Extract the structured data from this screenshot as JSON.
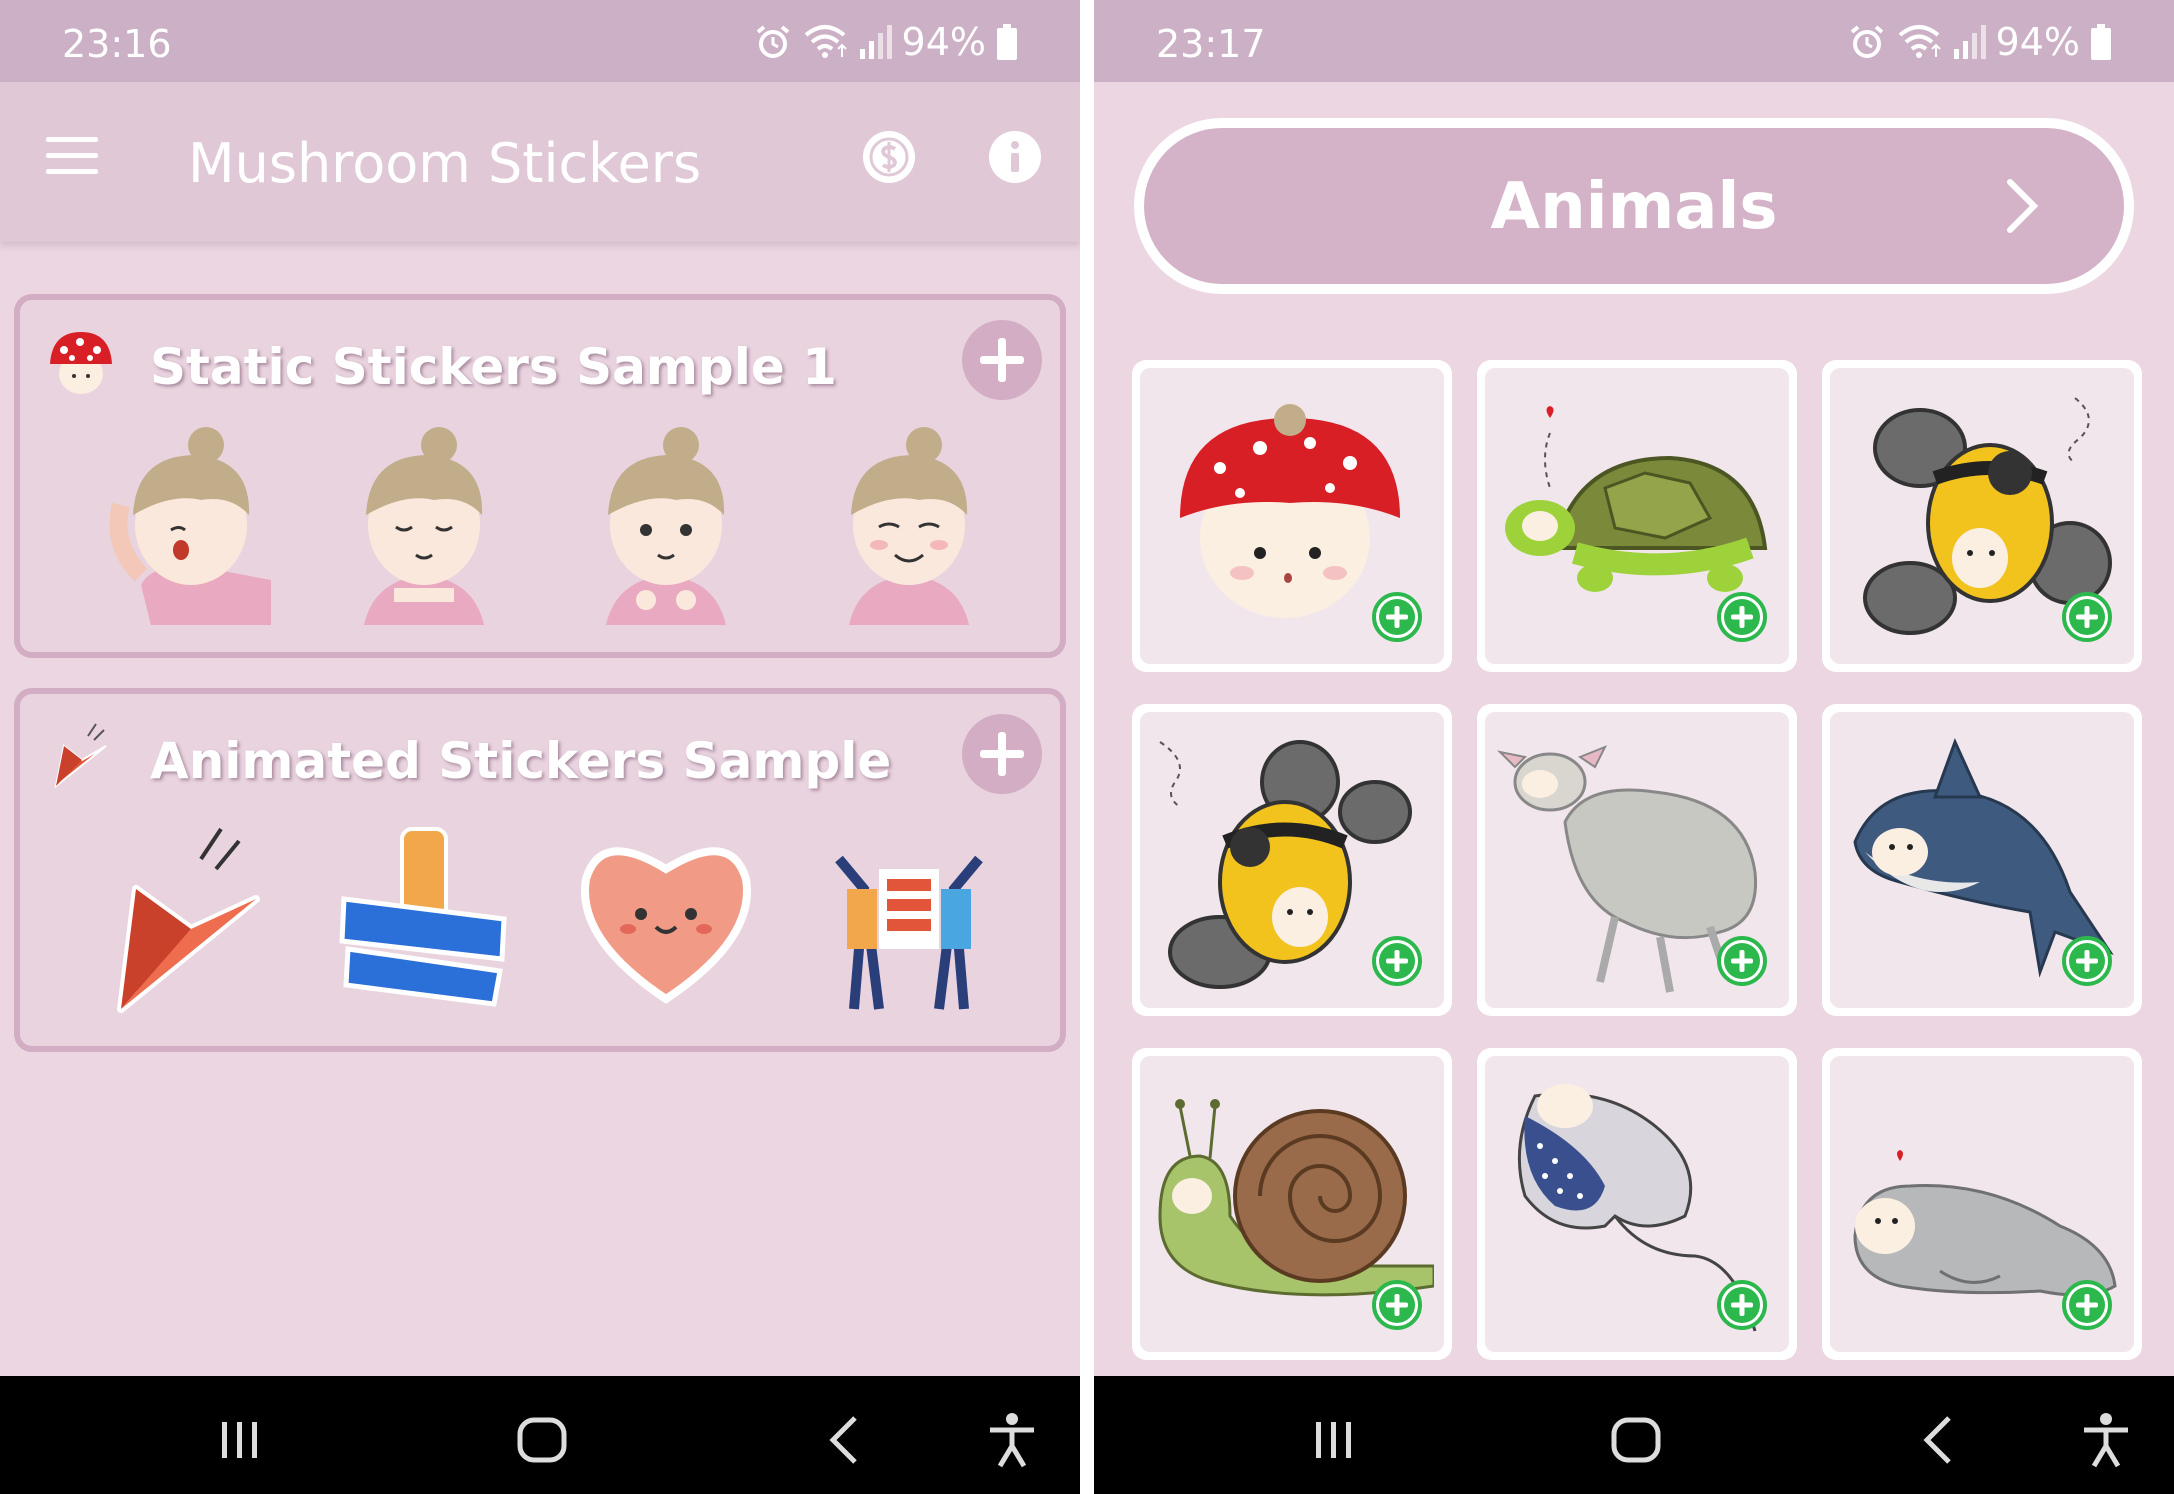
{
  "left_screen": {
    "status_bar": {
      "time": "23:16",
      "battery": "94%"
    },
    "app_bar": {
      "title": "Mushroom Stickers"
    },
    "packs": [
      {
        "name": "Static Stickers Sample 1"
      },
      {
        "name": "Animated Stickers Sample"
      }
    ]
  },
  "right_screen": {
    "status_bar": {
      "time": "23:17",
      "battery": "94%"
    },
    "category": {
      "label": "Animals"
    }
  },
  "icons": {
    "menu": "hamburger-menu-icon",
    "coin": "dollar-coin-icon",
    "info": "info-icon",
    "add": "plus-icon",
    "sticker_add": "green-plus-circle-icon",
    "nav": [
      "recent-apps-icon",
      "home-icon",
      "back-icon",
      "accessibility-icon"
    ]
  },
  "colors": {
    "background": "#ebd6e2",
    "status_bar": "#ccb0c5",
    "app_bar": "#e0c8d7",
    "card_border": "#d2adc3",
    "category_button": "#d4b3c8",
    "add_green": "#2db84d"
  }
}
